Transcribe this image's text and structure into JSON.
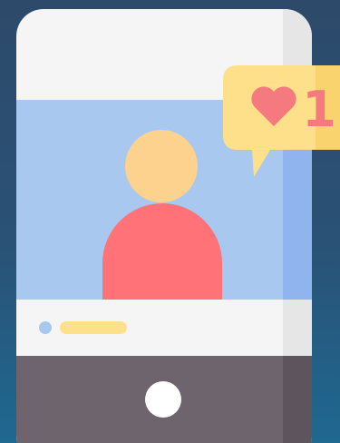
{
  "illustration": {
    "subject": "phone-profile-like-notification",
    "notification": {
      "icon": "heart-icon",
      "count": "1"
    },
    "colors": {
      "background_top": "#2d4a6a",
      "background_bottom": "#1f6890",
      "phone_body": "#f5f5f5",
      "phone_edge_shadow": "#e6e6e6",
      "screen": "#a8c8f0",
      "screen_shadow": "#8fb4ee",
      "avatar_head": "#fdd28f",
      "avatar_body": "#ff7278",
      "dot": "#a8c8f0",
      "text_bar": "#ffe08a",
      "bottom_bezel": "#6e646e",
      "bottom_bezel_shadow": "#5e545e",
      "home_button": "#ffffff",
      "bubble": "#ffe08a",
      "bubble_shadow": "#f8d36e",
      "heart": "#f47a7f"
    }
  }
}
